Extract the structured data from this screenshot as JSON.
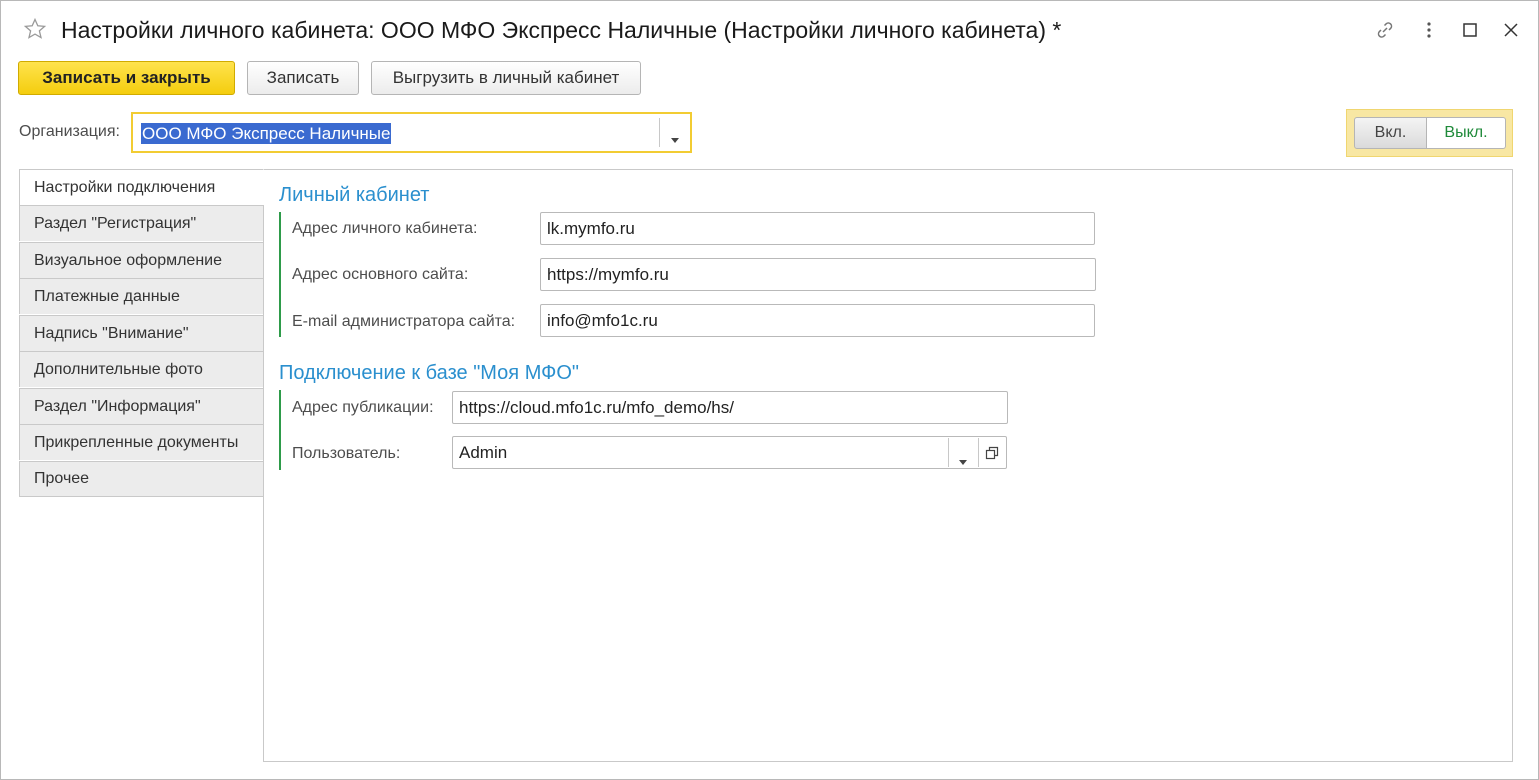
{
  "window": {
    "title": "Настройки личного кабинета: ООО МФО Экспресс Наличные (Настройки личного кабинета) *"
  },
  "toolbar": {
    "save_close_label": "Записать и закрыть",
    "save_label": "Записать",
    "export_label": "Выгрузить в личный кабинет"
  },
  "organization": {
    "label": "Организация:",
    "value": "ООО МФО Экспресс Наличные"
  },
  "toggle": {
    "on_label": "Вкл.",
    "off_label": "Выкл.",
    "selected": "Выкл."
  },
  "tabs": [
    {
      "label": "Настройки подключения",
      "active": true
    },
    {
      "label": "Раздел \"Регистрация\""
    },
    {
      "label": "Визуальное оформление"
    },
    {
      "label": "Платежные данные"
    },
    {
      "label": "Надпись \"Внимание\""
    },
    {
      "label": "Дополнительные фото"
    },
    {
      "label": "Раздел \"Информация\""
    },
    {
      "label": "Прикрепленные документы"
    },
    {
      "label": "Прочее"
    }
  ],
  "cabinet": {
    "title": "Личный кабинет",
    "fields": [
      {
        "label": "Адрес личного кабинета:",
        "value": "lk.mymfo.ru"
      },
      {
        "label": "Адрес основного сайта:",
        "value": "https://mymfo.ru"
      },
      {
        "label": "E-mail администратора сайта:",
        "value": "info@mfo1c.ru"
      }
    ]
  },
  "connection": {
    "title": "Подключение к базе \"Моя МФО\"",
    "publication_label": "Адрес публикации:",
    "publication_value": "https://cloud.mfo1c.ru/mfo_demo/hs/",
    "user_label": "Пользователь:",
    "user_value": "Admin"
  },
  "colors": {
    "accent_yellow": "#f4cd0e",
    "section_title_blue": "#2a8fce",
    "group_bar_green": "#2e9b4a",
    "selection_blue": "#3a6ad0"
  }
}
